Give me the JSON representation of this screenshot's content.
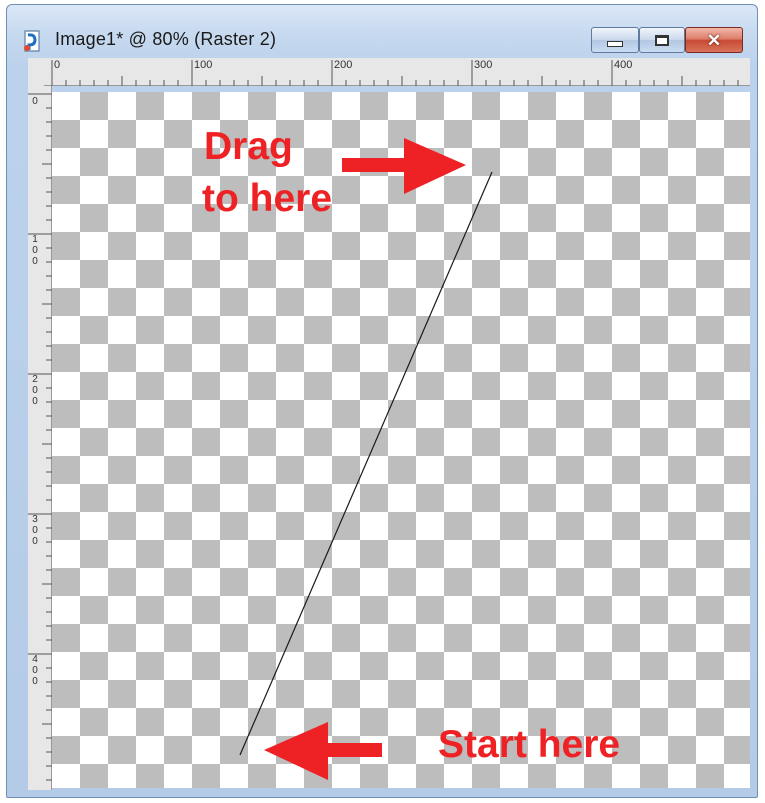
{
  "window": {
    "title": "Image1* @  80% (Raster 2)",
    "buttons": {
      "minimize": "minimize",
      "maximize": "maximize",
      "close": "✕"
    }
  },
  "rulers": {
    "horizontal_labels": [
      "0",
      "100",
      "200",
      "300",
      "400"
    ],
    "vertical_labels": [
      "0",
      "100",
      "200",
      "300",
      "400"
    ]
  },
  "annotations": {
    "drag_line1": "Drag",
    "drag_line2": "to here",
    "start": "Start here"
  },
  "colors": {
    "annotation": "#ee2124",
    "checker_dark": "#bdbdbd",
    "checker_light": "#ffffff"
  },
  "icons": [
    "app-icon",
    "minimize-icon",
    "maximize-icon",
    "close-icon",
    "arrow-right-icon",
    "arrow-left-icon"
  ]
}
